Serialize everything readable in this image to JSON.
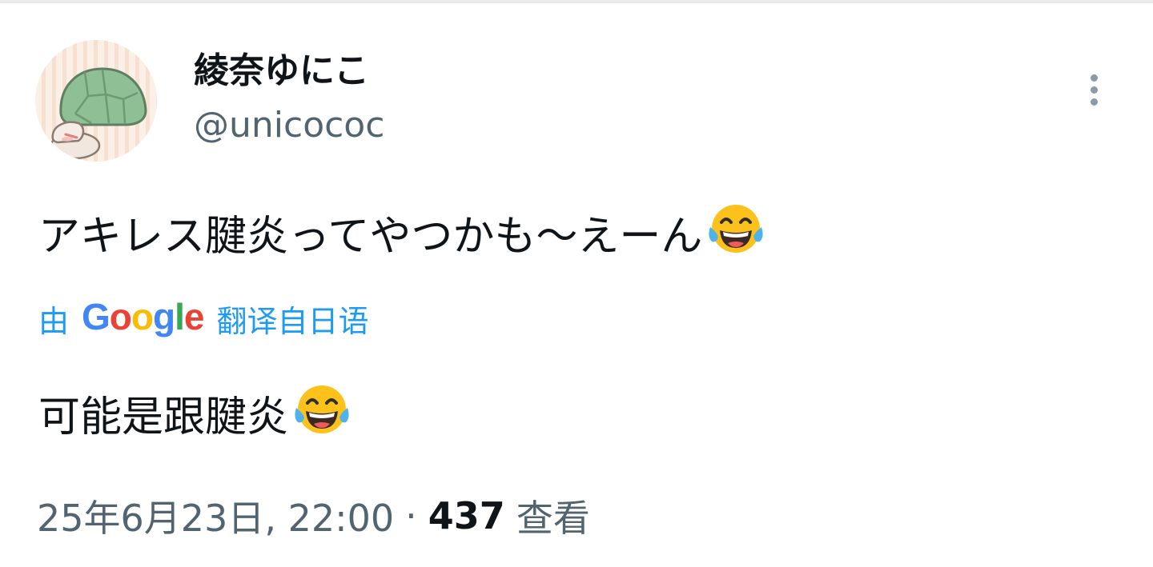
{
  "user": {
    "display_name": "綾奈ゆにこ",
    "handle": "@unicococ"
  },
  "tweet": {
    "text": "アキレス腱炎ってやつかも〜えーん",
    "text_emoji": "face-with-tears-of-joy"
  },
  "translation": {
    "prefix": "由",
    "logo_letters": [
      "G",
      "o",
      "o",
      "g",
      "l",
      "e"
    ],
    "suffix": "翻译自日语",
    "text": "可能是跟腱炎",
    "text_emoji": "face-with-tears-of-joy"
  },
  "meta": {
    "timestamp": "25年6月23日, 22:00",
    "separator": "·",
    "view_count": "437",
    "views_label": "查看"
  },
  "icons": {
    "avatar": "turtle-avatar-icon",
    "more": "more-vertical-icon"
  },
  "colors": {
    "link": "#1d9bf0",
    "text_primary": "#0f1419",
    "text_secondary": "#536471",
    "google_blue": "#4285f4",
    "google_red": "#ea4335",
    "google_yellow": "#fbbc05",
    "google_green": "#34a853"
  }
}
